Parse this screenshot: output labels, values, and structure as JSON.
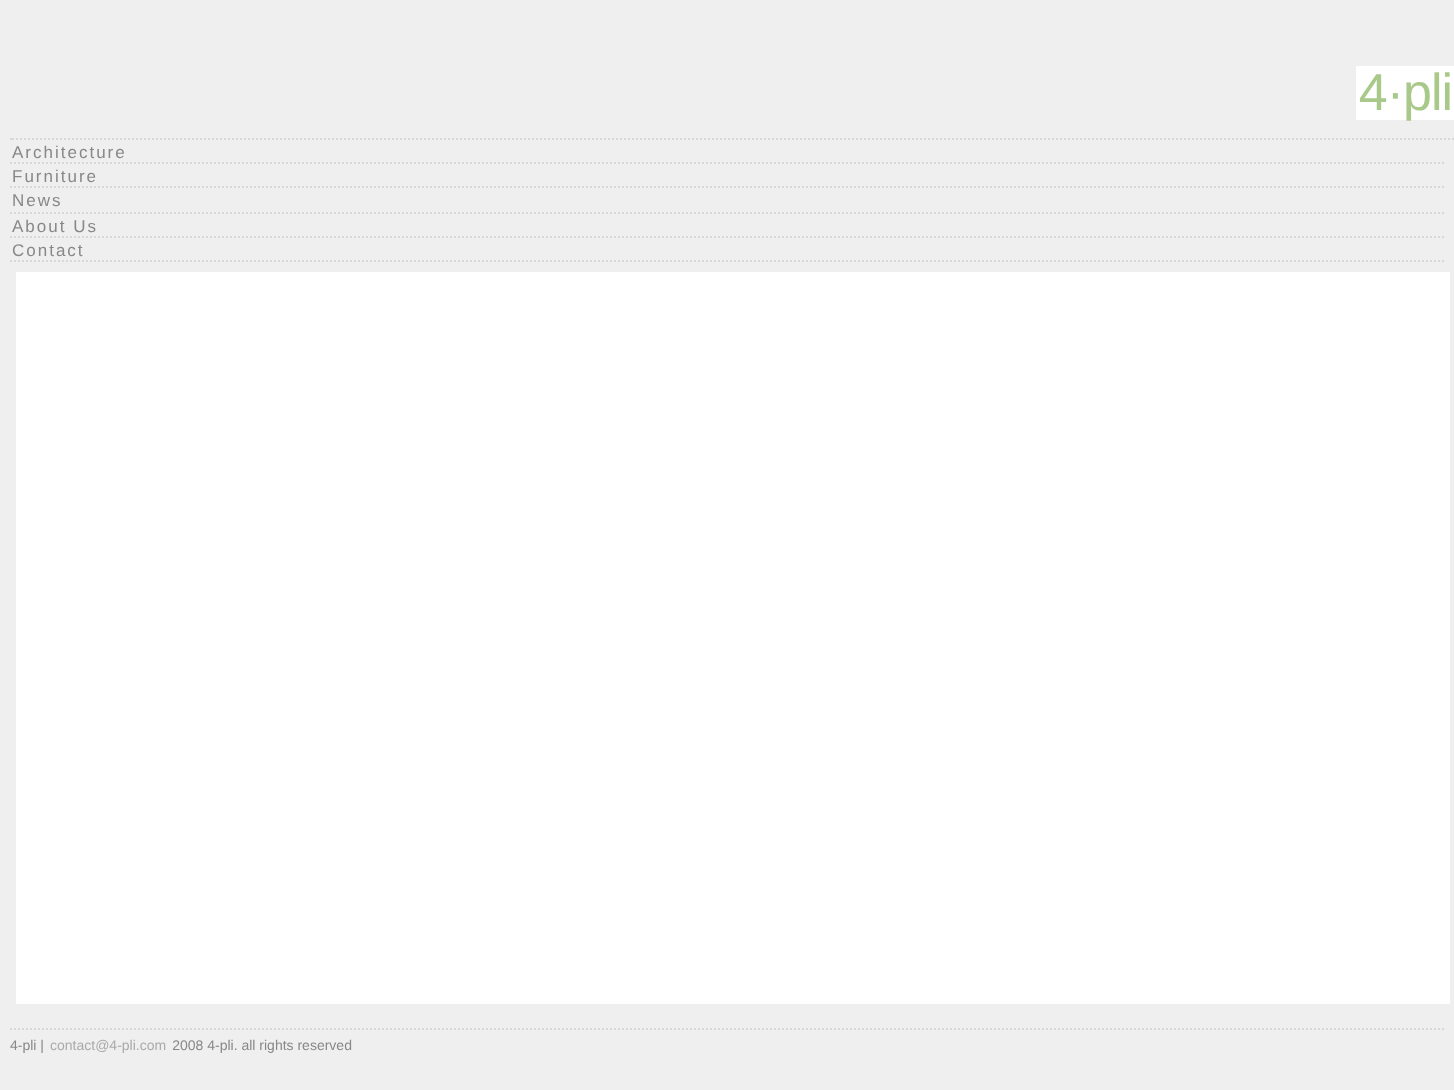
{
  "logo": "4·pli",
  "nav": [
    {
      "label": "Architecture"
    },
    {
      "label": "Furniture"
    },
    {
      "label": "News"
    },
    {
      "label": "About Us"
    },
    {
      "label": "Contact"
    }
  ],
  "footer": {
    "site": "4-pli |",
    "email": "contact@4-pli.com",
    "copyright": "2008 4-pli. all rights reserved"
  }
}
